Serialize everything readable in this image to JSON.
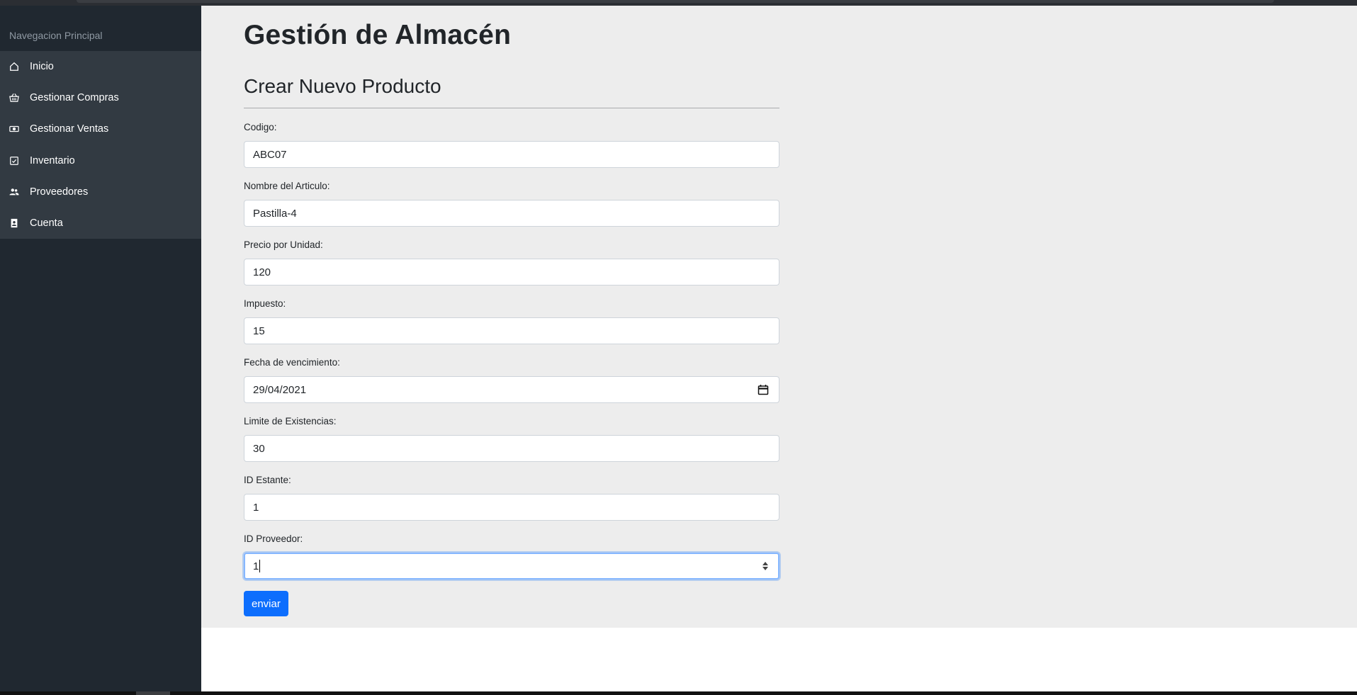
{
  "sidebar": {
    "heading": "Navegacion Principal",
    "items": [
      {
        "label": "Inicio",
        "icon": "home-icon"
      },
      {
        "label": "Gestionar Compras",
        "icon": "basket-icon"
      },
      {
        "label": "Gestionar Ventas",
        "icon": "cash-icon"
      },
      {
        "label": "Inventario",
        "icon": "checklist-icon"
      },
      {
        "label": "Proveedores",
        "icon": "people-icon"
      },
      {
        "label": "Cuenta",
        "icon": "contact-card-icon"
      }
    ]
  },
  "main": {
    "title": "Gestión de Almacén",
    "subtitle": "Crear Nuevo Producto",
    "fields": [
      {
        "label": "Codigo:",
        "value": "ABC07"
      },
      {
        "label": "Nombre del Articulo:",
        "value": "Pastilla-4"
      },
      {
        "label": "Precio por Unidad:",
        "value": "120"
      },
      {
        "label": "Impuesto:",
        "value": "15"
      },
      {
        "label": "Fecha de vencimiento:",
        "value": "29/04/2021"
      },
      {
        "label": "Limite de Existencias:",
        "value": "30"
      },
      {
        "label": "ID Estante:",
        "value": "1"
      },
      {
        "label": "ID Proveedor:",
        "value": "1"
      }
    ],
    "submit_label": "enviar"
  },
  "colors": {
    "sidebar_bg": "#202830",
    "menu_bg": "#323a42",
    "main_bg": "#ededed",
    "accent": "#0d6efd"
  }
}
